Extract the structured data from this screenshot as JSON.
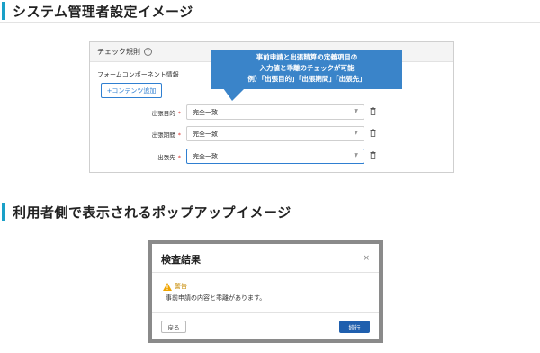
{
  "sections": {
    "admin_heading": "システム管理者設定イメージ",
    "user_heading": "利用者側で表示されるポップアップイメージ"
  },
  "settings_panel": {
    "title": "チェック規則",
    "help_icon": "?",
    "subheading": "フォームコンポーネント情報",
    "add_button": "+コンテンツ追加",
    "fields": [
      {
        "label": "出張目的",
        "required_mark": "*",
        "value": "完全一致"
      },
      {
        "label": "出張期間",
        "required_mark": "*",
        "value": "完全一致"
      },
      {
        "label": "出張先",
        "required_mark": "*",
        "value": "完全一致"
      }
    ],
    "dropdown_icon": "chevron-down-icon",
    "delete_icon": "trash-icon"
  },
  "callout": {
    "line1": "事前申請と出張精算の定義項目の",
    "line2": "入力値と乖離のチェックが可能",
    "line3": "例）「出張目的」「出張期間」「出張先」",
    "color": "#3a84c9"
  },
  "dialog": {
    "title": "検査結果",
    "close": "×",
    "warning_label": "警告",
    "warning_message": "事前申請の内容と乖離があります。",
    "back_button": "戻る",
    "continue_button": "続行",
    "primary_color": "#1f5fae",
    "warning_color": "#f0a500"
  },
  "accent_color": "#1aa0c8"
}
